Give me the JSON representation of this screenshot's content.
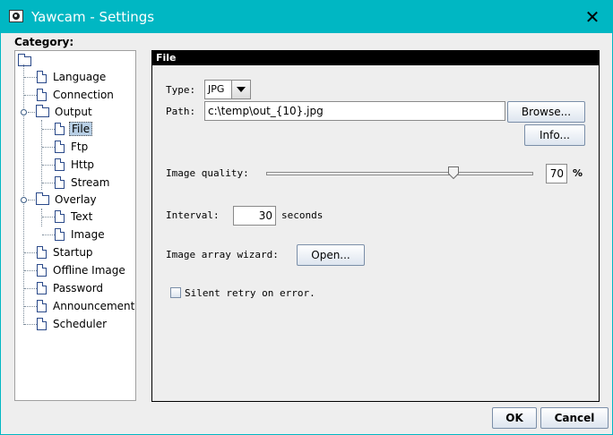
{
  "window": {
    "title": "Yawcam - Settings",
    "close_symbol": "✕"
  },
  "category_label": "Category:",
  "tree": {
    "items": [
      {
        "label": "Language",
        "icon": "document-icon"
      },
      {
        "label": "Connection",
        "icon": "document-icon"
      },
      {
        "label": "Output",
        "icon": "folder-icon",
        "expanded": true
      },
      {
        "label": "File",
        "icon": "document-icon",
        "selected": true
      },
      {
        "label": "Ftp",
        "icon": "document-icon"
      },
      {
        "label": "Http",
        "icon": "document-icon"
      },
      {
        "label": "Stream",
        "icon": "document-icon"
      },
      {
        "label": "Overlay",
        "icon": "folder-icon",
        "expanded": true
      },
      {
        "label": "Text",
        "icon": "document-icon"
      },
      {
        "label": "Image",
        "icon": "document-icon"
      },
      {
        "label": "Startup",
        "icon": "document-icon"
      },
      {
        "label": "Offline Image",
        "icon": "document-icon"
      },
      {
        "label": "Password",
        "icon": "document-icon"
      },
      {
        "label": "Announcements",
        "icon": "document-icon"
      },
      {
        "label": "Scheduler",
        "icon": "document-icon"
      }
    ]
  },
  "panel": {
    "header": "File",
    "type_label": "Type:",
    "type_value": "JPG",
    "path_label": "Path:",
    "path_value": "c:\\temp\\out_{10}.jpg",
    "browse_button": "Browse...",
    "info_button": "Info...",
    "quality_label": "Image quality:",
    "quality_value": "70",
    "quality_fraction": 0.7,
    "quality_unit": "%",
    "interval_label": "Interval:",
    "interval_value": "30",
    "interval_unit": "seconds",
    "wizard_label": "Image array wizard:",
    "open_button": "Open...",
    "silent_retry_label": "Silent retry on error.",
    "silent_retry_checked": false
  },
  "footer": {
    "ok_button": "OK",
    "cancel_button": "Cancel"
  },
  "colors": {
    "titlebar": "#00b7c3",
    "selection": "#b8cfe5"
  }
}
